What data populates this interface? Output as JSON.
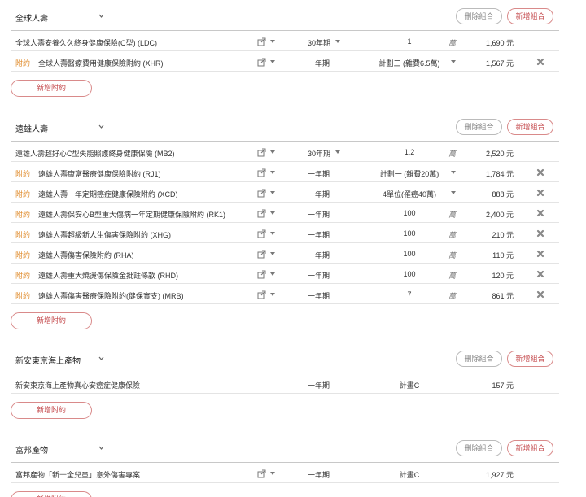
{
  "labels": {
    "delete_combo": "刪除組合",
    "add_combo": "新增組合",
    "add_rider": "新增附約",
    "rider_tag": "附約"
  },
  "companies": [
    {
      "name": "全球人壽",
      "rows": [
        {
          "rider": false,
          "name": "全球人壽安養久久終身健康保險(C型) (LDC)",
          "link": true,
          "term": "30年期",
          "term_dropdown": true,
          "amount": "1",
          "amount_dropdown": false,
          "unit": "萬",
          "premium": "1,690 元",
          "removable": false
        },
        {
          "rider": true,
          "name": "全球人壽醫療費用健康保險附約 (XHR)",
          "link": true,
          "term": "一年期",
          "term_dropdown": false,
          "amount": "計劃三 (雜費6.5萬)",
          "amount_dropdown": true,
          "unit": "",
          "premium": "1,567 元",
          "removable": true
        }
      ]
    },
    {
      "name": "遠雄人壽",
      "rows": [
        {
          "rider": false,
          "name": "遠雄人壽超好心C型失能照護終身健康保險 (MB2)",
          "link": true,
          "term": "30年期",
          "term_dropdown": true,
          "amount": "1.2",
          "amount_dropdown": false,
          "unit": "萬",
          "premium": "2,520 元",
          "removable": false
        },
        {
          "rider": true,
          "name": "遠雄人壽康富醫療健康保險附約 (RJ1)",
          "link": true,
          "term": "一年期",
          "term_dropdown": false,
          "amount": "計劃一 (雜費20萬)",
          "amount_dropdown": true,
          "unit": "",
          "premium": "1,784 元",
          "removable": true
        },
        {
          "rider": true,
          "name": "遠雄人壽一年定期癌症健康保險附約 (XCD)",
          "link": true,
          "term": "一年期",
          "term_dropdown": false,
          "amount": "4單位(罹癌40萬)",
          "amount_dropdown": true,
          "unit": "",
          "premium": "888 元",
          "removable": true
        },
        {
          "rider": true,
          "name": "遠雄人壽保安心B型重大傷病一年定期健康保險附約 (RK1)",
          "link": true,
          "term": "一年期",
          "term_dropdown": false,
          "amount": "100",
          "amount_dropdown": false,
          "unit": "萬",
          "premium": "2,400 元",
          "removable": true
        },
        {
          "rider": true,
          "name": "遠雄人壽超級新人生傷害保險附約 (XHG)",
          "link": true,
          "term": "一年期",
          "term_dropdown": false,
          "amount": "100",
          "amount_dropdown": false,
          "unit": "萬",
          "premium": "210 元",
          "removable": true
        },
        {
          "rider": true,
          "name": "遠雄人壽傷害保險附約 (RHA)",
          "link": true,
          "term": "一年期",
          "term_dropdown": false,
          "amount": "100",
          "amount_dropdown": false,
          "unit": "萬",
          "premium": "110 元",
          "removable": true
        },
        {
          "rider": true,
          "name": "遠雄人壽重大燒燙傷保險金批註條款 (RHD)",
          "link": true,
          "term": "一年期",
          "term_dropdown": false,
          "amount": "100",
          "amount_dropdown": false,
          "unit": "萬",
          "premium": "120 元",
          "removable": true
        },
        {
          "rider": true,
          "name": "遠雄人壽傷害醫療保險附約(健保實支) (MRB)",
          "link": true,
          "term": "一年期",
          "term_dropdown": false,
          "amount": "7",
          "amount_dropdown": false,
          "unit": "萬",
          "premium": "861 元",
          "removable": true
        }
      ]
    },
    {
      "name": "新安東京海上產物",
      "rows": [
        {
          "rider": false,
          "name": "新安東京海上產物真心安癌症健康保險",
          "link": false,
          "term": "一年期",
          "term_dropdown": false,
          "amount": "計畫C",
          "amount_dropdown": false,
          "unit": "",
          "premium": "157 元",
          "removable": false
        }
      ]
    },
    {
      "name": "富邦產物",
      "rows": [
        {
          "rider": false,
          "name": "富邦產物「新十全兒童」意外傷害專案",
          "link": true,
          "term": "一年期",
          "term_dropdown": false,
          "amount": "計畫C",
          "amount_dropdown": false,
          "unit": "",
          "premium": "1,927 元",
          "removable": false
        }
      ]
    }
  ]
}
